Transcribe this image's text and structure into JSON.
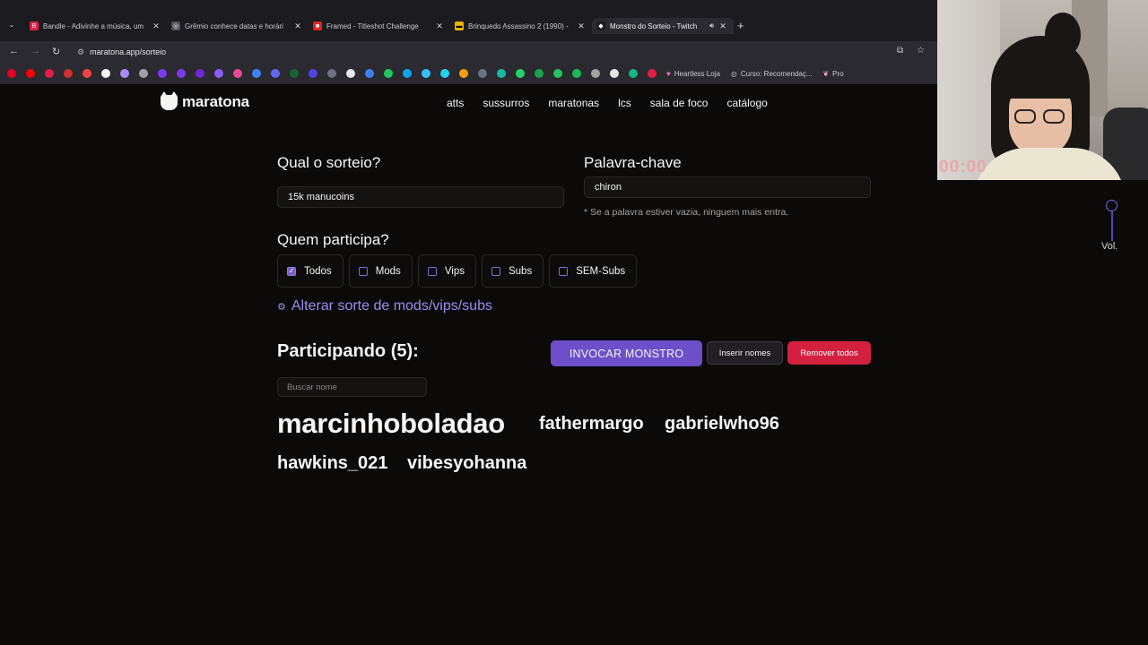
{
  "browser": {
    "tabs": [
      {
        "title": "Bandle - Adivinhe a música, um",
        "favicon_color": "#e11d48",
        "favicon": "B",
        "active": false,
        "sound": false
      },
      {
        "title": "Grêmio conhece datas e horári",
        "favicon_color": "#52525b",
        "favicon": "◎",
        "active": false,
        "sound": false
      },
      {
        "title": "Framed - Titleshot Challenge",
        "favicon_color": "#dc2626",
        "favicon": "■",
        "active": false,
        "sound": false
      },
      {
        "title": "Brinquedo Assassino 2 (1990) -",
        "favicon_color": "#eab308",
        "favicon": "▬",
        "active": false,
        "sound": false
      },
      {
        "title": "Monstro do Sorteio - Twitch",
        "favicon_color": "#1f1f23",
        "favicon": "◆",
        "active": true,
        "sound": true
      }
    ],
    "new_tab_icon": "plus-icon",
    "address": "maratona.app/sorteio",
    "bookmarks": [
      {
        "label": "Heartless Loja",
        "icon": "heart-icon"
      },
      {
        "label": "Curso: Recomendaç...",
        "icon": "globe-icon"
      },
      {
        "label": "Pro",
        "icon": "brain-icon"
      }
    ],
    "bookmark_icon_colors": [
      "#e60023",
      "#ff0000",
      "#e11d48",
      "#d32f2f",
      "#ef4444",
      "#f5f5f5",
      "#a78bfa",
      "#a1a1aa",
      "#7c3aed",
      "#7c3aed",
      "#6d28d9",
      "#8b5cf6",
      "#ec4899",
      "#3b82f6",
      "#6366f1",
      "#166534",
      "#4f46e5",
      "#6b7280",
      "#e5e7eb",
      "#3b82f6",
      "#22c55e",
      "#0ea5e9",
      "#38bdf8",
      "#22d3ee",
      "#f59e0b",
      "#6b7280",
      "#14b8a6",
      "#25d366",
      "#16a34a",
      "#22c55e",
      "#1db954",
      "#a3a3a3",
      "#e5e5e5",
      "#10b981",
      "#e11d48"
    ]
  },
  "site": {
    "logo_text": "maratona",
    "menu": [
      "atts",
      "sussurros",
      "maratonas",
      "lcs",
      "sala de foco",
      "catálogo"
    ]
  },
  "form": {
    "raffle_label": "Qual o sorteio?",
    "raffle_value": "15k manucoins",
    "keyword_label": "Palavra-chave",
    "keyword_value": "chiron",
    "keyword_hint": "* Se a palavra estiver vazia, ninguem mais entra.",
    "who_label": "Quem participa?",
    "options": [
      {
        "label": "Todos",
        "checked": true
      },
      {
        "label": "Mods",
        "checked": false
      },
      {
        "label": "Vips",
        "checked": false
      },
      {
        "label": "Subs",
        "checked": false
      },
      {
        "label": "SEM-Subs",
        "checked": false
      }
    ],
    "alter_luck": "Alterar sorte de mods/vips/subs"
  },
  "participants": {
    "title": "Participando (5):",
    "invoke_button": "INVOCAR MONSTRO",
    "insert_button": "Inserir nomes",
    "remove_button": "Remover todos",
    "search_placeholder": "Buscar nome",
    "names": [
      "marcinhoboladao",
      "fathermargo",
      "gabrielwho96",
      "hawkins_021",
      "vibesyohanna"
    ]
  },
  "overlay": {
    "timer": "00:00",
    "volume_label": "Vol."
  },
  "colors": {
    "accent": "#6c4fc9",
    "danger": "#d3203f",
    "link": "#9d8cf0",
    "background": "#0c0a09"
  }
}
